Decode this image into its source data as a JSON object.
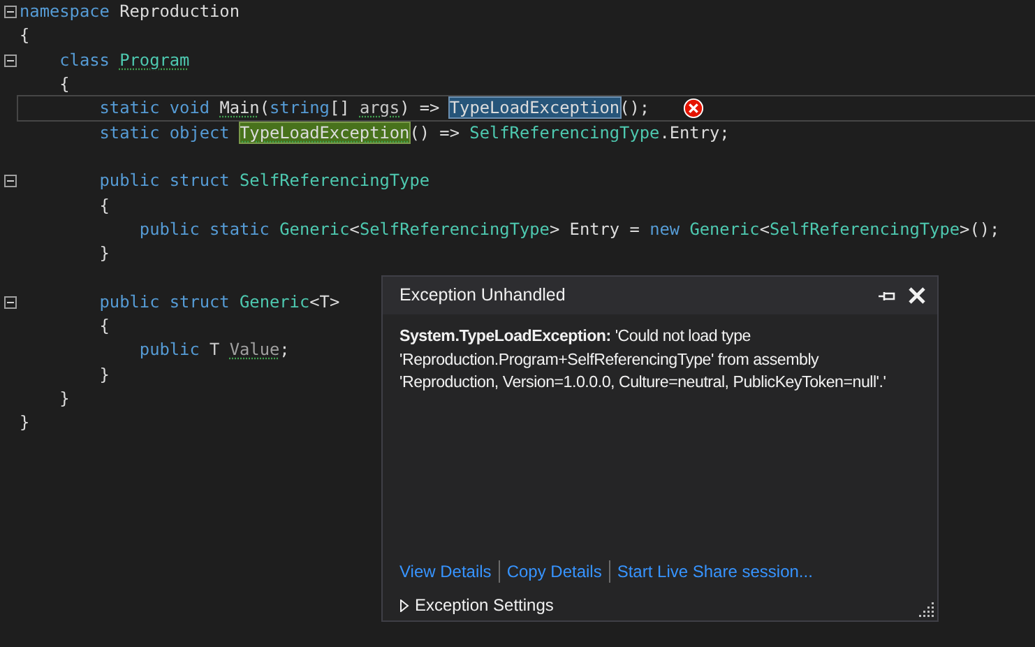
{
  "editor": {
    "lines": [
      {
        "fold": true,
        "current": false,
        "error": false,
        "tokens": [
          {
            "text": "namespace ",
            "kind": "keyword",
            "squiggle": false
          },
          {
            "text": "Reproduction",
            "kind": "text",
            "squiggle": false
          }
        ]
      },
      {
        "fold": false,
        "current": false,
        "error": false,
        "tokens": [
          {
            "text": "{",
            "kind": "text",
            "squiggle": false
          }
        ]
      },
      {
        "fold": true,
        "current": false,
        "error": false,
        "tokens": [
          {
            "text": "    class ",
            "kind": "keyword",
            "squiggle": false
          },
          {
            "text": "Program",
            "kind": "type",
            "squiggle": true
          }
        ]
      },
      {
        "fold": false,
        "current": false,
        "error": false,
        "tokens": [
          {
            "text": "    {",
            "kind": "text",
            "squiggle": false
          }
        ]
      },
      {
        "fold": false,
        "current": true,
        "error": true,
        "tokens": [
          {
            "text": "        static void ",
            "kind": "keyword",
            "squiggle": false
          },
          {
            "text": "Main",
            "kind": "method",
            "squiggle": true
          },
          {
            "text": "(",
            "kind": "text",
            "squiggle": false
          },
          {
            "text": "string",
            "kind": "keyword",
            "squiggle": false
          },
          {
            "text": "[] ",
            "kind": "text",
            "squiggle": false
          },
          {
            "text": "args",
            "kind": "param",
            "squiggle": true
          },
          {
            "text": ") => ",
            "kind": "text",
            "squiggle": false
          },
          {
            "text": "TypeLoadException",
            "kind": "reference",
            "squiggle": false
          },
          {
            "text": "();",
            "kind": "text",
            "squiggle": false
          }
        ]
      },
      {
        "fold": false,
        "current": false,
        "error": false,
        "tokens": [
          {
            "text": "        static object ",
            "kind": "keyword",
            "squiggle": false
          },
          {
            "text": "TypeLoadException",
            "kind": "definition",
            "squiggle": true
          },
          {
            "text": "() => ",
            "kind": "text",
            "squiggle": false
          },
          {
            "text": "SelfReferencingType",
            "kind": "type",
            "squiggle": false
          },
          {
            "text": ".Entry;",
            "kind": "text",
            "squiggle": false
          }
        ]
      },
      {
        "fold": false,
        "current": false,
        "error": false
      },
      {
        "fold": true,
        "current": false,
        "error": false,
        "tokens": [
          {
            "text": "        public struct ",
            "kind": "keyword",
            "squiggle": false
          },
          {
            "text": "SelfReferencingType",
            "kind": "type",
            "squiggle": false
          }
        ]
      },
      {
        "fold": false,
        "current": false,
        "error": false,
        "tokens": [
          {
            "text": "        {",
            "kind": "text",
            "squiggle": false
          }
        ]
      },
      {
        "fold": false,
        "current": false,
        "error": false,
        "tokens": [
          {
            "text": "            public static ",
            "kind": "keyword",
            "squiggle": false
          },
          {
            "text": "Generic",
            "kind": "type",
            "squiggle": false
          },
          {
            "text": "<",
            "kind": "text",
            "squiggle": false
          },
          {
            "text": "SelfReferencingType",
            "kind": "type",
            "squiggle": false
          },
          {
            "text": "> Entry = ",
            "kind": "text",
            "squiggle": false
          },
          {
            "text": "new ",
            "kind": "keyword",
            "squiggle": false
          },
          {
            "text": "Generic",
            "kind": "type",
            "squiggle": false
          },
          {
            "text": "<",
            "kind": "text",
            "squiggle": false
          },
          {
            "text": "SelfReferencingType",
            "kind": "type",
            "squiggle": false
          },
          {
            "text": ">();",
            "kind": "text",
            "squiggle": false
          }
        ]
      },
      {
        "fold": false,
        "current": false,
        "error": false,
        "tokens": [
          {
            "text": "        }",
            "kind": "text",
            "squiggle": false
          }
        ]
      },
      {
        "fold": false,
        "current": false,
        "error": false
      },
      {
        "fold": true,
        "current": false,
        "error": false,
        "tokens": [
          {
            "text": "        public struct ",
            "kind": "keyword",
            "squiggle": false
          },
          {
            "text": "Generic",
            "kind": "type",
            "squiggle": false
          },
          {
            "text": "<T>",
            "kind": "text",
            "squiggle": false
          }
        ]
      },
      {
        "fold": false,
        "current": false,
        "error": false,
        "tokens": [
          {
            "text": "        {",
            "kind": "text",
            "squiggle": false
          }
        ]
      },
      {
        "fold": false,
        "current": false,
        "error": false,
        "tokens": [
          {
            "text": "            public ",
            "kind": "keyword",
            "squiggle": false
          },
          {
            "text": "T ",
            "kind": "param",
            "squiggle": false
          },
          {
            "text": "Value",
            "kind": "unused",
            "squiggle": true
          },
          {
            "text": ";",
            "kind": "text",
            "squiggle": false
          }
        ]
      },
      {
        "fold": false,
        "current": false,
        "error": false,
        "tokens": [
          {
            "text": "        }",
            "kind": "text",
            "squiggle": false
          }
        ]
      },
      {
        "fold": false,
        "current": false,
        "error": false,
        "tokens": [
          {
            "text": "    }",
            "kind": "text",
            "squiggle": false
          }
        ]
      },
      {
        "fold": false,
        "current": false,
        "error": false,
        "tokens": [
          {
            "text": "}",
            "kind": "text",
            "squiggle": false
          }
        ]
      }
    ]
  },
  "exception_popup": {
    "title": "Exception Unhandled",
    "message": "**System.TypeLoadException:** 'Could not load type 'Reproduction.Program+SelfReferencingType' from assembly 'Reproduction, Version=1.0.0.0, Culture=neutral, PublicKeyToken=null'.'",
    "links": [
      "View Details",
      "Copy Details",
      "Start Live Share session..."
    ],
    "settings": {
      "label": "Exception Settings",
      "expanded": false
    }
  }
}
